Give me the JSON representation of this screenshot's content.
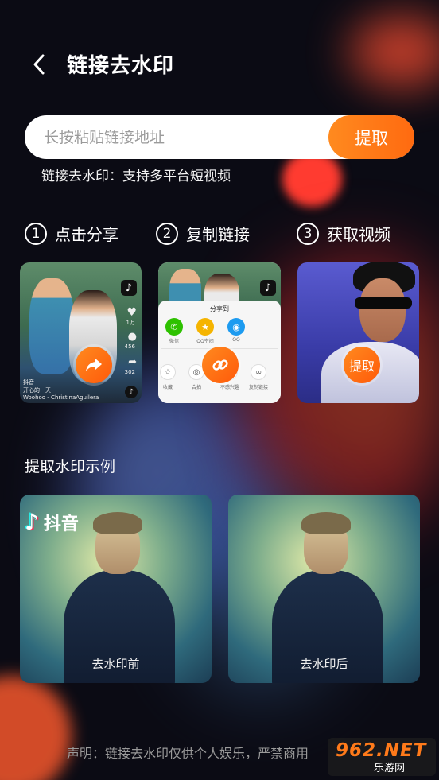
{
  "header": {
    "back_icon": "chevron-left-icon",
    "title": "链接去水印"
  },
  "search": {
    "placeholder": "长按粘贴链接地址",
    "value": "",
    "button_label": "提取"
  },
  "subtitle": "链接去水印：支持多平台短视频",
  "steps": [
    {
      "num": "1",
      "label": "点击分享"
    },
    {
      "num": "2",
      "label": "复制链接"
    },
    {
      "num": "3",
      "label": "获取视频"
    }
  ],
  "step_cards": {
    "card1": {
      "caption": "抖音",
      "caption2": "开心的一天!",
      "music": "Woohoo - ChristinaAguilera",
      "counts": [
        "1万",
        "456",
        "302"
      ],
      "action_icon": "share-arrow-icon"
    },
    "card2": {
      "panel_title": "分享到",
      "apps": [
        {
          "label": "微信",
          "icon": "wechat-icon",
          "color": "#2dc100"
        },
        {
          "label": "QQ空间",
          "icon": "qzone-icon",
          "color": "#f5b400"
        },
        {
          "label": "QQ",
          "icon": "qq-icon",
          "color": "#1d9bf0"
        }
      ],
      "actions": [
        "收藏",
        "合拍",
        "不感兴趣",
        "复制链接"
      ],
      "action_icon": "link-icon"
    },
    "card3": {
      "button_label": "提取"
    }
  },
  "example_section": {
    "title": "提取水印示例",
    "before_label": "去水印前",
    "after_label": "去水印后",
    "watermark_text": "抖音",
    "watermark_icon": "tiktok-note-icon"
  },
  "footer": {
    "disclaimer": "声明：链接去水印仅供个人娱乐，严禁商用",
    "site_badge_num": "962.NET",
    "site_badge_sub": "乐游网"
  },
  "colors": {
    "accent": "#ff7a1a",
    "background": "#0b0b14"
  }
}
